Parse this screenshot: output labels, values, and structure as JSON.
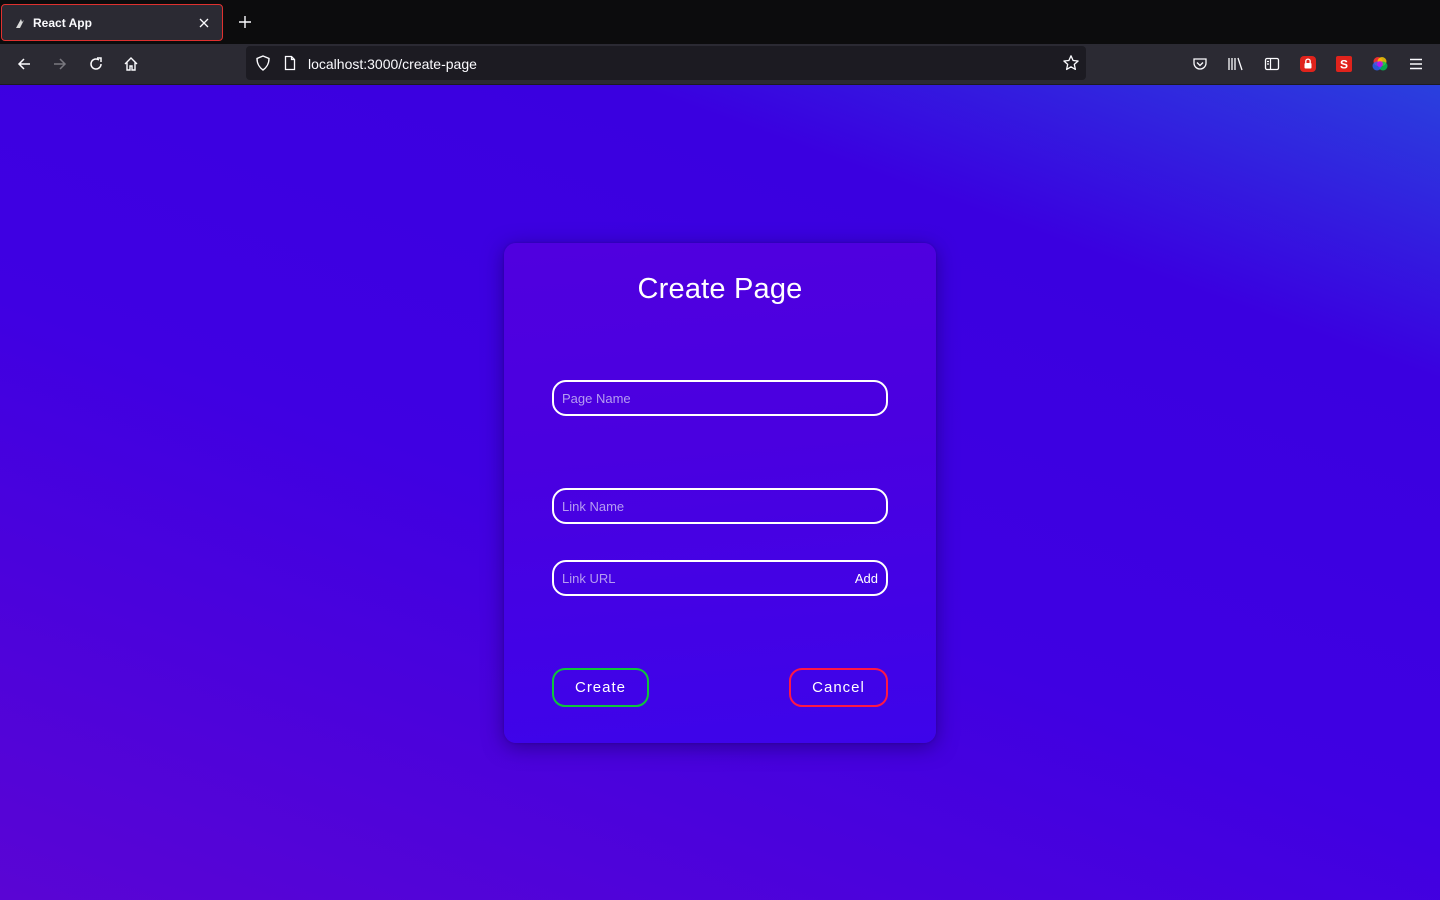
{
  "browser": {
    "tab_title": "React App",
    "url": "localhost:3000/create-page"
  },
  "form": {
    "title": "Create Page",
    "page_name_placeholder": "Page Name",
    "link_name_placeholder": "Link Name",
    "link_url_placeholder": "Link URL",
    "add_label": "Add",
    "create_label": "Create",
    "cancel_label": "Cancel"
  },
  "colors": {
    "create_border": "#10c43a",
    "cancel_border": "#ff1744",
    "tab_highlight": "#e0312f"
  },
  "icons": {
    "tab": [
      "react-favicon-icon",
      "close-icon",
      "plus-icon"
    ],
    "nav": [
      "back-icon",
      "forward-icon",
      "reload-icon",
      "home-icon"
    ],
    "url": [
      "shield-icon",
      "page-icon",
      "star-icon"
    ],
    "toolbar": [
      "pocket-icon",
      "library-icon",
      "sidebar-icon",
      "lock-extension-icon",
      "s-extension-icon",
      "color-wheel-icon",
      "menu-icon"
    ]
  }
}
